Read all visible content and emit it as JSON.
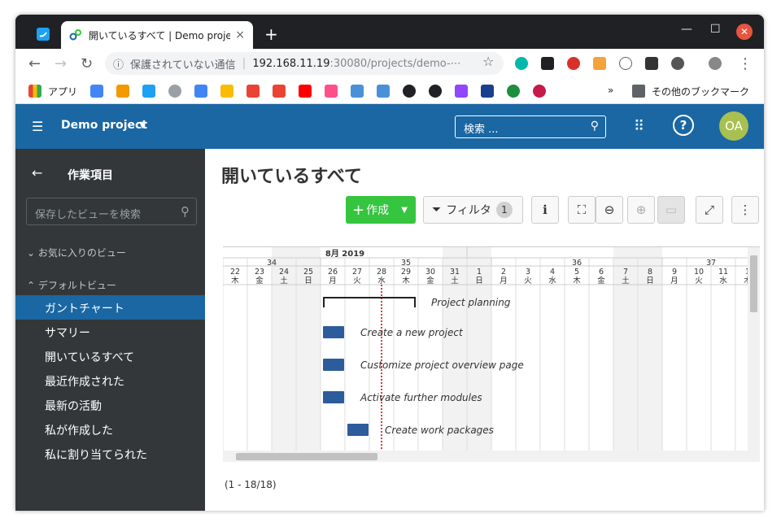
{
  "browser": {
    "tab_title": "開いているすべて | Demo project",
    "tab_close": "×",
    "new_tab": "+",
    "security_label": "保護されていない通信",
    "url_host": "192.168.11.19",
    "url_rest": ":30080/projects/demo-⋯",
    "window_controls": [
      "—",
      "☐"
    ],
    "win_close": "✕",
    "bookmarks": {
      "apps_label": "アプリ",
      "more": "»",
      "other_bookmarks": "その他のブックマーク"
    }
  },
  "header": {
    "project_name": "Demo project",
    "search_placeholder": "検索 ...",
    "avatar_initials": "OA",
    "help": "?"
  },
  "sidebar": {
    "back_title": "作業項目",
    "search_placeholder": "保存したビューを検索",
    "favorites_header": "お気に入りのビュー",
    "defaults_header": "デフォルトビュー",
    "items": [
      {
        "label": "ガントチャート",
        "active": true
      },
      {
        "label": "サマリー",
        "active": false
      },
      {
        "label": "開いているすべて",
        "active": false
      },
      {
        "label": "最近作成された",
        "active": false
      },
      {
        "label": "最新の活動",
        "active": false
      },
      {
        "label": "私が作成した",
        "active": false
      },
      {
        "label": "私に割り当てられた",
        "active": false
      }
    ]
  },
  "main": {
    "title": "開いているすべて",
    "create_label": "作成",
    "filter_label": "フィルタ",
    "filter_count": "1",
    "pagination": "(1 - 18/18)"
  },
  "gantt": {
    "month_label": "8月 2019",
    "weeks": [
      "34",
      "35",
      "36",
      "37"
    ],
    "days": [
      {
        "d": "22",
        "w": "木"
      },
      {
        "d": "23",
        "w": "金"
      },
      {
        "d": "24",
        "w": "土"
      },
      {
        "d": "25",
        "w": "日"
      },
      {
        "d": "26",
        "w": "月"
      },
      {
        "d": "27",
        "w": "火"
      },
      {
        "d": "28",
        "w": "水"
      },
      {
        "d": "29",
        "w": "木"
      },
      {
        "d": "30",
        "w": "金"
      },
      {
        "d": "31",
        "w": "土"
      },
      {
        "d": "1",
        "w": "日"
      },
      {
        "d": "2",
        "w": "月"
      },
      {
        "d": "3",
        "w": "火"
      },
      {
        "d": "4",
        "w": "水"
      },
      {
        "d": "5",
        "w": "木"
      },
      {
        "d": "6",
        "w": "金"
      },
      {
        "d": "7",
        "w": "土"
      },
      {
        "d": "8",
        "w": "日"
      },
      {
        "d": "9",
        "w": "月"
      },
      {
        "d": "10",
        "w": "火"
      },
      {
        "d": "11",
        "w": "水"
      },
      {
        "d": "1",
        "w": "木"
      }
    ],
    "tasks": [
      {
        "name": "Project planning",
        "start": "26",
        "end": "29",
        "kind": "phase"
      },
      {
        "name": "Create a new project",
        "start": "26",
        "end": "26",
        "kind": "task"
      },
      {
        "name": "Customize project overview page",
        "start": "26",
        "end": "26",
        "kind": "task"
      },
      {
        "name": "Activate further modules",
        "start": "26",
        "end": "26",
        "kind": "task"
      },
      {
        "name": "Create work packages",
        "start": "27",
        "end": "27",
        "kind": "task"
      }
    ],
    "today": "28",
    "colors": {
      "bar": "#2c5c9c",
      "weekend": "#f2f2f2",
      "today": "#c00000"
    }
  }
}
